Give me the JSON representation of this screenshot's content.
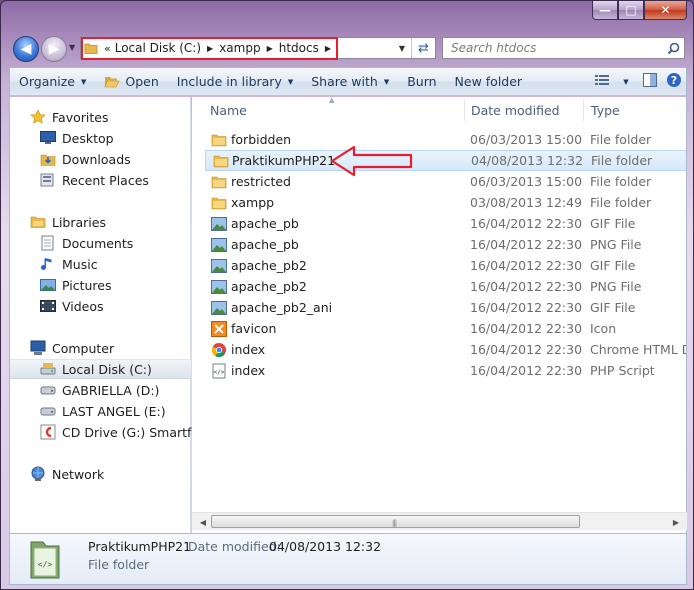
{
  "window": {
    "minimize": "—",
    "maximize": "□",
    "close": "✕"
  },
  "address": {
    "chevron": "«",
    "crumbs": [
      "Local Disk (C:)",
      "xampp",
      "htdocs"
    ]
  },
  "search": {
    "placeholder": "Search htdocs"
  },
  "toolbar": {
    "organize": "Organize",
    "open": "Open",
    "include": "Include in library",
    "share": "Share with",
    "burn": "Burn",
    "new_folder": "New folder"
  },
  "nav": {
    "favorites": "Favorites",
    "desktop": "Desktop",
    "downloads": "Downloads",
    "recent": "Recent Places",
    "libraries": "Libraries",
    "documents": "Documents",
    "music": "Music",
    "pictures": "Pictures",
    "videos": "Videos",
    "computer": "Computer",
    "local_disk": "Local Disk (C:)",
    "gabriella": "GABRIELLA (D:)",
    "last_angel": "LAST ANGEL (E:)",
    "cd_drive": "CD Drive (G:) Smartfren",
    "network": "Network"
  },
  "columns": {
    "name": "Name",
    "date": "Date modified",
    "type": "Type"
  },
  "files": [
    {
      "name": "forbidden",
      "date": "06/03/2013 15:00",
      "type": "File folder",
      "icon": "folder-icon"
    },
    {
      "name": "PraktikumPHP21",
      "date": "04/08/2013 12:32",
      "type": "File folder",
      "icon": "folder-icon"
    },
    {
      "name": "restricted",
      "date": "06/03/2013 15:00",
      "type": "File folder",
      "icon": "folder-icon"
    },
    {
      "name": "xampp",
      "date": "03/08/2013 12:49",
      "type": "File folder",
      "icon": "folder-icon"
    },
    {
      "name": "apache_pb",
      "date": "16/04/2012 22:30",
      "type": "GIF File",
      "icon": "image-icon"
    },
    {
      "name": "apache_pb",
      "date": "16/04/2012 22:30",
      "type": "PNG File",
      "icon": "image-icon"
    },
    {
      "name": "apache_pb2",
      "date": "16/04/2012 22:30",
      "type": "GIF File",
      "icon": "image-icon"
    },
    {
      "name": "apache_pb2",
      "date": "16/04/2012 22:30",
      "type": "PNG File",
      "icon": "image-icon"
    },
    {
      "name": "apache_pb2_ani",
      "date": "16/04/2012 22:30",
      "type": "GIF File",
      "icon": "image-icon"
    },
    {
      "name": "favicon",
      "date": "16/04/2012 22:30",
      "type": "Icon",
      "icon": "favicon-icon"
    },
    {
      "name": "index",
      "date": "16/04/2012 22:30",
      "type": "Chrome HTML Do",
      "icon": "chrome-icon"
    },
    {
      "name": "index",
      "date": "16/04/2012 22:30",
      "type": "PHP Script",
      "icon": "script-icon"
    }
  ],
  "details": {
    "name": "PraktikumPHP21",
    "date_label": "Date modified:",
    "date": "04/08/2013 12:32",
    "type": "File folder"
  },
  "colors": {
    "annotation": "#e81e2c",
    "selection": "#d6e9fb",
    "folder": "#e8b84a"
  }
}
